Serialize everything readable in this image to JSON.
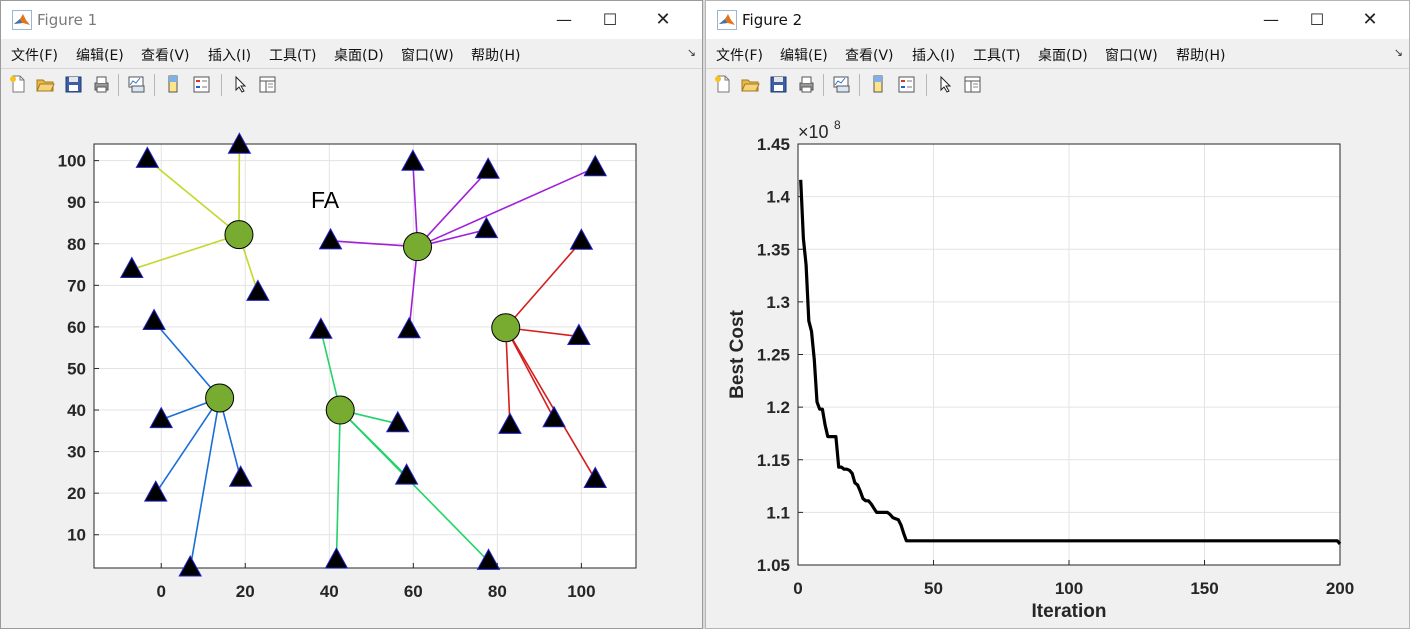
{
  "menus": [
    "文件(F)",
    "编辑(E)",
    "查看(V)",
    "插入(I)",
    "工具(T)",
    "桌面(D)",
    "窗口(W)",
    "帮助(H)"
  ],
  "window_buttons": {
    "minimize": "—",
    "maximize": "☐",
    "close": "✕"
  },
  "toolbar_icons": [
    "new-figure-icon",
    "open-file-icon",
    "save-icon",
    "print-icon",
    "link-plot-icon",
    "insert-colorbar-icon",
    "insert-legend-icon",
    "edit-plot-arrow-icon",
    "property-inspector-icon"
  ],
  "figure1": {
    "window_title": "Figure 1",
    "chart_data": {
      "type": "scatter",
      "title": "FA",
      "xlim": [
        -16,
        113
      ],
      "ylim": [
        2,
        104
      ],
      "xticks": [
        0,
        20,
        40,
        60,
        80,
        100
      ],
      "yticks": [
        10,
        20,
        30,
        40,
        50,
        60,
        70,
        80,
        90,
        100
      ],
      "grid": true,
      "clusters": [
        {
          "color": "#c4d82a",
          "center": [
            18.5,
            82.2
          ],
          "members": [
            [
              -3.3,
              100.3
            ],
            [
              18.6,
              103.7
            ],
            [
              -7,
              73.8
            ],
            [
              23,
              68.3
            ]
          ]
        },
        {
          "color": "#a020d8",
          "center": [
            61,
            79.3
          ],
          "members": [
            [
              59.9,
              99.6
            ],
            [
              40.3,
              80.7
            ],
            [
              77.8,
              97.7
            ],
            [
              77.4,
              83.4
            ],
            [
              103.3,
              98.3
            ],
            [
              59,
              59.3
            ]
          ]
        },
        {
          "color": "#d41e1e",
          "center": [
            82,
            59.8
          ],
          "members": [
            [
              100,
              80.6
            ],
            [
              99.4,
              57.7
            ],
            [
              93.5,
              37.9
            ],
            [
              83,
              36.3
            ],
            [
              103.3,
              23.3
            ]
          ]
        },
        {
          "color": "#1a6ed8",
          "center": [
            13.9,
            42.9
          ],
          "members": [
            [
              -1.7,
              61.3
            ],
            [
              0,
              37.7
            ],
            [
              -1.3,
              20
            ],
            [
              18.9,
              23.6
            ],
            [
              6.9,
              2
            ]
          ]
        },
        {
          "color": "#22d36a",
          "center": [
            42.6,
            40
          ],
          "members": [
            [
              38,
              59.2
            ],
            [
              56.3,
              36.7
            ],
            [
              58.4,
              24.1
            ],
            [
              77.9,
              3.6
            ],
            [
              41.7,
              3.9
            ]
          ]
        }
      ]
    }
  },
  "figure2": {
    "window_title": "Figure 2",
    "chart_data": {
      "type": "line",
      "xlabel": "Iteration",
      "ylabel": "Best Cost",
      "exponent_label": "×10",
      "exponent_power": "8",
      "xlim": [
        0,
        200
      ],
      "ylim": [
        1.05,
        1.45
      ],
      "xticks": [
        0,
        50,
        100,
        150,
        200
      ],
      "yticks": [
        1.05,
        1.1,
        1.15,
        1.2,
        1.25,
        1.3,
        1.35,
        1.4,
        1.45
      ],
      "ytick_labels": [
        "1.05",
        "1.1",
        "1.15",
        "1.2",
        "1.25",
        "1.3",
        "1.35",
        "1.4",
        "1.45"
      ],
      "grid": true,
      "series": [
        {
          "color": "#000000",
          "x": [
            1,
            2,
            3,
            4,
            5,
            6,
            7,
            8,
            9,
            10,
            11,
            12,
            13,
            14,
            15,
            16,
            17,
            18,
            19,
            20,
            21,
            22,
            23,
            24,
            25,
            26,
            27,
            28,
            29,
            30,
            31,
            32,
            33,
            34,
            35,
            36,
            37,
            38,
            39,
            40,
            41,
            42,
            50,
            100,
            150,
            199,
            200
          ],
          "y": [
            1.416,
            1.36,
            1.335,
            1.282,
            1.272,
            1.245,
            1.205,
            1.198,
            1.198,
            1.183,
            1.172,
            1.172,
            1.172,
            1.172,
            1.143,
            1.143,
            1.141,
            1.141,
            1.14,
            1.137,
            1.128,
            1.126,
            1.12,
            1.113,
            1.111,
            1.111,
            1.108,
            1.104,
            1.1,
            1.1,
            1.1,
            1.1,
            1.1,
            1.098,
            1.095,
            1.094,
            1.093,
            1.088,
            1.08,
            1.073,
            1.073,
            1.073,
            1.073,
            1.073,
            1.073,
            1.073,
            1.07
          ]
        }
      ]
    }
  }
}
